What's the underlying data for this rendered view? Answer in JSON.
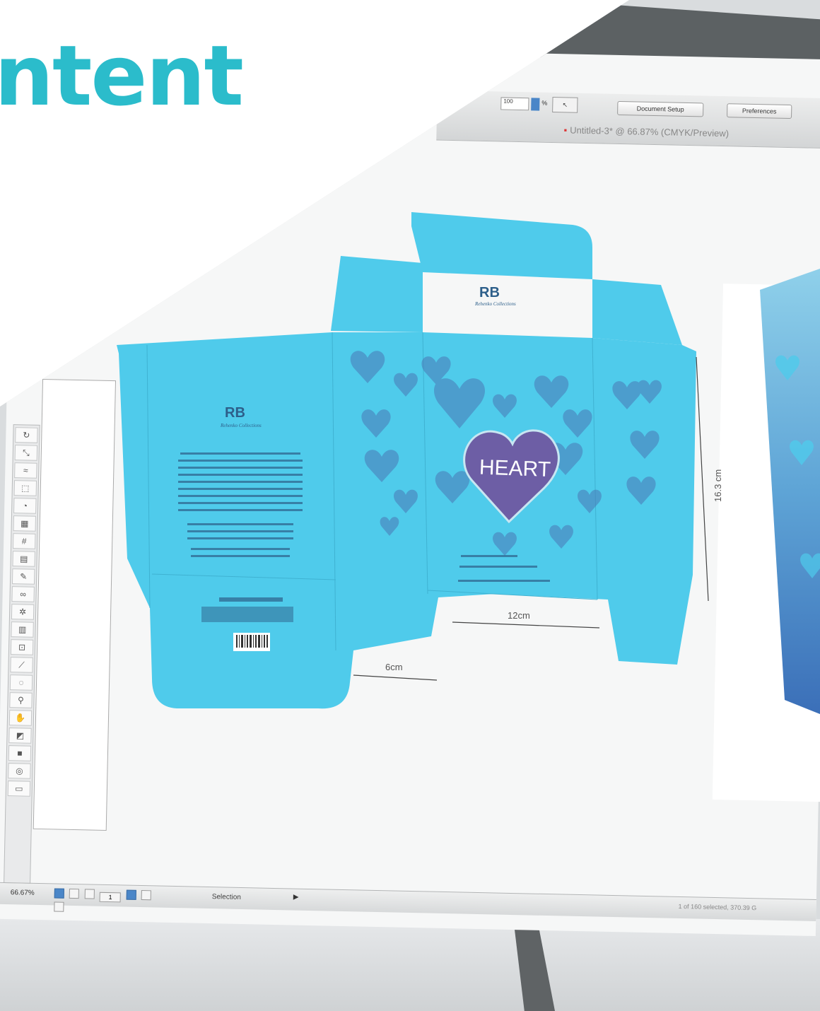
{
  "headline": "ntent",
  "toolbar": {
    "zoom_field": "100",
    "percent": "%",
    "arrow": "↖",
    "doc_setup_label": "Document Setup",
    "preferences_label": "Preferences",
    "doc_tab": "Untitled-3* @ 66.87% (CMYK/Preview)"
  },
  "artwork": {
    "brand_mark": "RB",
    "brand_name": "Rehenko Collections",
    "heart_text": "HEART",
    "dim_height": "16.3 cm",
    "dim_width": "12cm",
    "dim_depth": "6cm"
  },
  "statusbar": {
    "zoom": "66.67%",
    "page": "1",
    "tool": "Selection",
    "info": "1 of 160 selected, 370.39 G"
  },
  "colors": {
    "accent": "#2bbccb",
    "box_cyan": "#4fcbeb",
    "heart_purple": "#6d5ea5"
  }
}
